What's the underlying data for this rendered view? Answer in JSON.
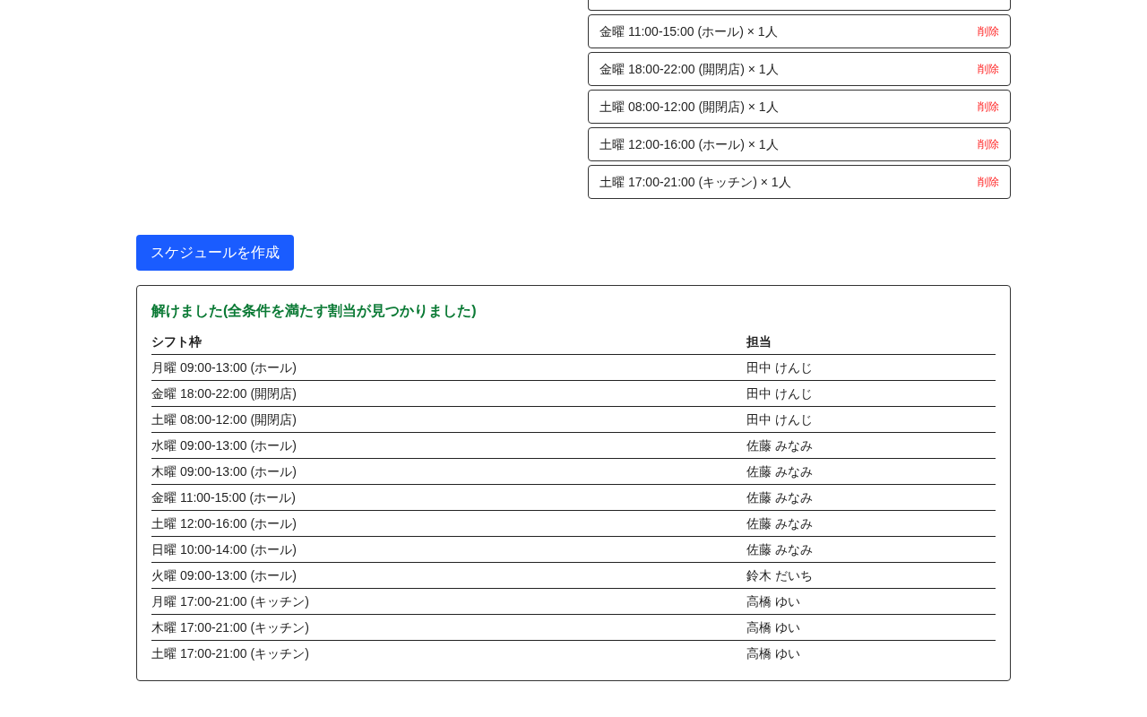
{
  "shift_list": {
    "items": [
      {
        "label": "金曜 11:00-15:00 (ホール) × 1人",
        "action": "削除"
      },
      {
        "label": "金曜 18:00-22:00 (開閉店) × 1人",
        "action": "削除"
      },
      {
        "label": "土曜 08:00-12:00 (開閉店) × 1人",
        "action": "削除"
      },
      {
        "label": "土曜 12:00-16:00 (ホール) × 1人",
        "action": "削除"
      },
      {
        "label": "土曜 17:00-21:00 (キッチン) × 1人",
        "action": "削除"
      }
    ]
  },
  "create_button": {
    "label": "スケジュールを作成"
  },
  "result": {
    "title": "解けました(全条件を満たす割当が見つかりました)",
    "columns": [
      "シフト枠",
      "担当"
    ],
    "rows": [
      [
        "月曜 09:00-13:00 (ホール)",
        "田中 けんじ"
      ],
      [
        "金曜 18:00-22:00 (開閉店)",
        "田中 けんじ"
      ],
      [
        "土曜 08:00-12:00 (開閉店)",
        "田中 けんじ"
      ],
      [
        "水曜 09:00-13:00 (ホール)",
        "佐藤 みなみ"
      ],
      [
        "木曜 09:00-13:00 (ホール)",
        "佐藤 みなみ"
      ],
      [
        "金曜 11:00-15:00 (ホール)",
        "佐藤 みなみ"
      ],
      [
        "土曜 12:00-16:00 (ホール)",
        "佐藤 みなみ"
      ],
      [
        "日曜 10:00-14:00 (ホール)",
        "佐藤 みなみ"
      ],
      [
        "火曜 09:00-13:00 (ホール)",
        "鈴木 だいち"
      ],
      [
        "月曜 17:00-21:00 (キッチン)",
        "高橋 ゆい"
      ],
      [
        "木曜 17:00-21:00 (キッチン)",
        "高橋 ゆい"
      ],
      [
        "土曜 17:00-21:00 (キッチン)",
        "高橋 ゆい"
      ]
    ]
  }
}
